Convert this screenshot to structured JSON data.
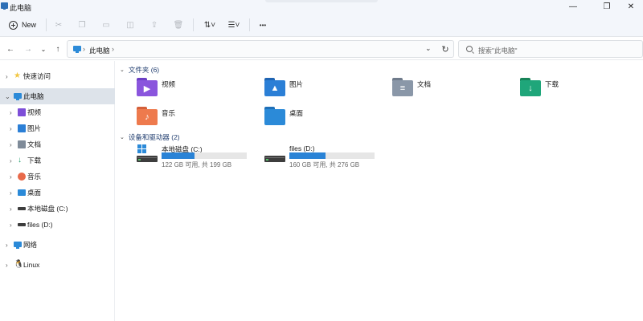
{
  "window": {
    "title": "此电脑",
    "minimize_glyph": "—",
    "maximize_glyph": "❐",
    "close_glyph": "✕"
  },
  "toolbar": {
    "new_label": "New",
    "more_glyph": "•••"
  },
  "nav": {
    "back": "←",
    "forward": "→",
    "recent": "⌄",
    "up": "↑"
  },
  "address": {
    "location": "此电脑",
    "separator": "›",
    "dropdown": "⌄",
    "refresh": "↻"
  },
  "search": {
    "placeholder": "搜索\"此电脑\""
  },
  "sidebar": {
    "items": [
      {
        "label": "快速访问",
        "icon": "star-icon",
        "color": "#f2c744"
      },
      {
        "label": "此电脑",
        "icon": "pc-icon",
        "color": "#2b8ad8",
        "selected": true
      },
      {
        "label": "视频",
        "icon": "video-folder-icon",
        "color": "#7d4ed8"
      },
      {
        "label": "图片",
        "icon": "pictures-folder-icon",
        "color": "#2b7fd6"
      },
      {
        "label": "文档",
        "icon": "documents-folder-icon",
        "color": "#7f8b99"
      },
      {
        "label": "下载",
        "icon": "downloads-folder-icon",
        "color": "#1f9e6b"
      },
      {
        "label": "音乐",
        "icon": "music-folder-icon",
        "color": "#e8694a"
      },
      {
        "label": "桌面",
        "icon": "desktop-folder-icon",
        "color": "#2b8ad8"
      },
      {
        "label": "本地磁盘 (C:)",
        "icon": "drive-icon",
        "color": "#3d3d3d"
      },
      {
        "label": "files (D:)",
        "icon": "drive-icon",
        "color": "#3d3d3d"
      },
      {
        "label": "网络",
        "icon": "network-icon",
        "color": "#2b8ad8"
      },
      {
        "label": "Linux",
        "icon": "linux-penguin-icon",
        "color": "#222222"
      }
    ]
  },
  "content": {
    "folders_header": "文件夹 (6)",
    "drives_header": "设备和驱动器 (2)",
    "folders": [
      {
        "label": "视频",
        "icon": "video-folder-icon",
        "color": "#8a55dd",
        "glyph": "▶"
      },
      {
        "label": "图片",
        "icon": "pictures-folder-icon",
        "color": "#2b7fd6",
        "glyph": "▲"
      },
      {
        "label": "文档",
        "icon": "documents-folder-icon",
        "color": "#8a97a8",
        "glyph": "≡"
      },
      {
        "label": "下载",
        "icon": "downloads-folder-icon",
        "color": "#1fa67a",
        "glyph": "↓"
      },
      {
        "label": "音乐",
        "icon": "music-folder-icon",
        "color": "#ee7a4d",
        "glyph": "♪"
      },
      {
        "label": "桌面",
        "icon": "desktop-folder-icon",
        "color": "#2b8ad8",
        "glyph": ""
      }
    ],
    "drives": [
      {
        "name": "本地磁盘 (C:)",
        "usage": "122 GB 可用, 共 199 GB",
        "used_fraction": 0.387,
        "windows": true
      },
      {
        "name": "files (D:)",
        "usage": "160 GB 可用, 共 276 GB",
        "used_fraction": 0.42,
        "windows": false
      }
    ]
  }
}
